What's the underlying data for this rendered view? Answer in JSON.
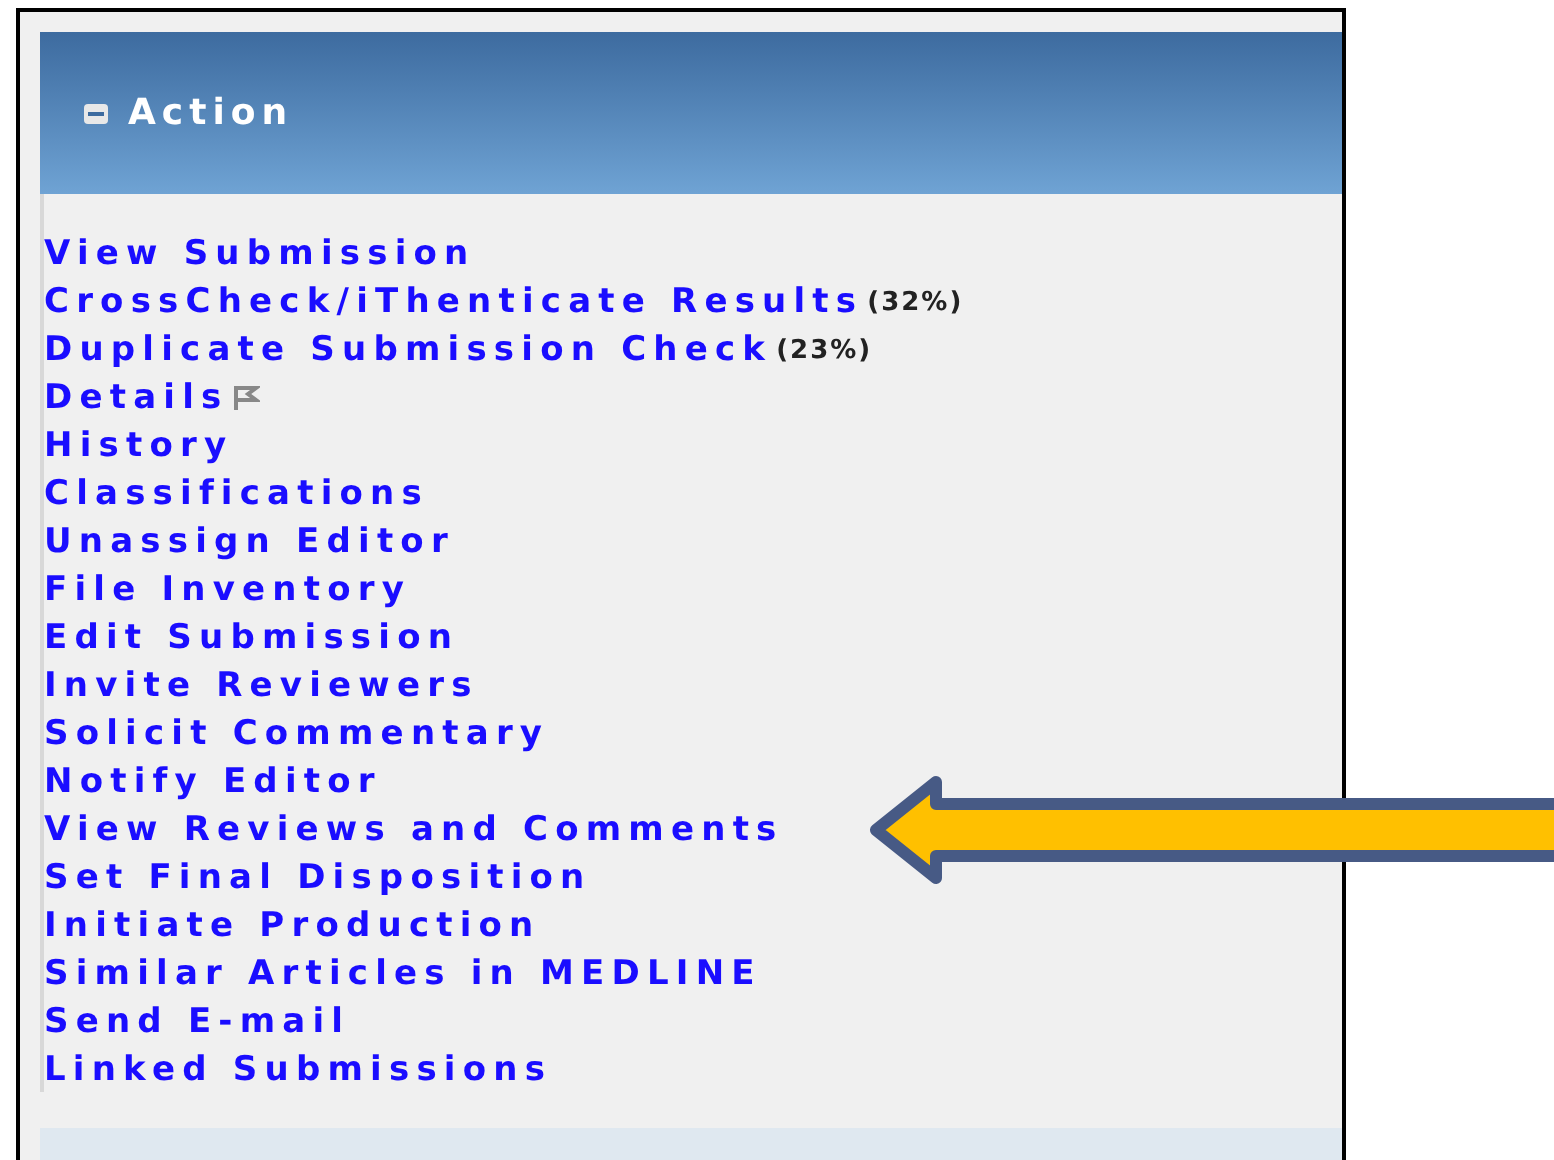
{
  "panel": {
    "title": "Action",
    "expanded": true
  },
  "links": [
    {
      "label": "View Submission"
    },
    {
      "label": "CrossCheck/iThenticate Results",
      "note": "(32%)"
    },
    {
      "label": "Duplicate Submission Check",
      "note": "(23%)"
    },
    {
      "label": "Details",
      "flag": true
    },
    {
      "label": "History"
    },
    {
      "label": "Classifications"
    },
    {
      "label": "Unassign Editor"
    },
    {
      "label": "File Inventory"
    },
    {
      "label": "Edit Submission"
    },
    {
      "label": "Invite Reviewers"
    },
    {
      "label": "Solicit Commentary"
    },
    {
      "label": "Notify Editor"
    },
    {
      "label": "View Reviews and Comments"
    },
    {
      "label": "Set Final Disposition"
    },
    {
      "label": "Initiate Production"
    },
    {
      "label": "Similar Articles in MEDLINE"
    },
    {
      "label": "Send E-mail"
    },
    {
      "label": "Linked Submissions"
    }
  ]
}
